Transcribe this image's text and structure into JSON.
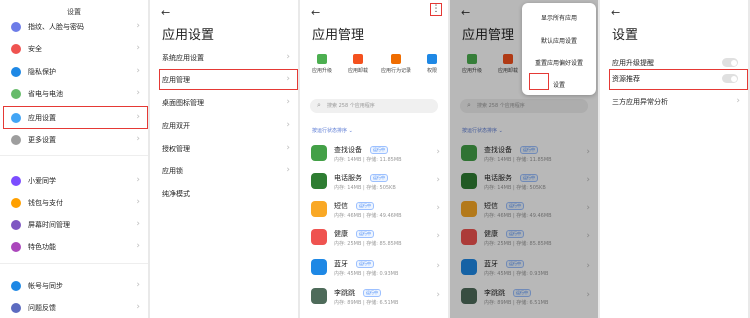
{
  "panel1": {
    "title": "设置",
    "items": [
      {
        "label": "指纹、人脸与密码",
        "color": "#6d7ce8"
      },
      {
        "label": "安全",
        "color": "#ef5350"
      },
      {
        "label": "隐私保护",
        "color": "#1e88e5"
      },
      {
        "label": "省电与电池",
        "color": "#66bb6a"
      },
      {
        "label": "应用设置",
        "color": "#42a5f5"
      },
      {
        "label": "更多设置",
        "color": "#9e9e9e"
      },
      {
        "label": "小爱同学",
        "color": "#7c4dff"
      },
      {
        "label": "钱包与支付",
        "color": "#ffa000"
      },
      {
        "label": "屏幕时间管理",
        "color": "#7e57c2"
      },
      {
        "label": "特色功能",
        "color": "#ab47bc"
      },
      {
        "label": "帐号与同步",
        "color": "#1e88e5"
      },
      {
        "label": "问题反馈",
        "color": "#5c6bc0"
      }
    ]
  },
  "panel2": {
    "title": "应用设置",
    "items": [
      "系统应用设置",
      "应用管理",
      "桌面图标管理",
      "应用双开",
      "授权管理",
      "应用锁",
      "纯净模式"
    ]
  },
  "panel3": {
    "title": "应用管理",
    "more_glyph": "⋮",
    "toolbar": [
      {
        "label": "应用升级",
        "color": "#4caf50"
      },
      {
        "label": "应用卸载",
        "color": "#f4511e"
      },
      {
        "label": "应用行为记录",
        "color": "#ef6c00"
      },
      {
        "label": "权限",
        "color": "#1e88e5"
      }
    ],
    "search_placeholder": "搜索 258 个应用程序",
    "sort_label": "按运行状态排序 ⌄",
    "apps": [
      {
        "name": "查找设备",
        "badge": "运行中",
        "meta": "内存: 14MB | 存储: 11.85MB",
        "color": "#43a047"
      },
      {
        "name": "电话服务",
        "badge": "运行中",
        "meta": "内存: 14MB | 存储: 505KB",
        "color": "#2e7d32"
      },
      {
        "name": "短信",
        "badge": "运行中",
        "meta": "内存: 46MB | 存储: 49.46MB",
        "color": "#f9a825"
      },
      {
        "name": "健康",
        "badge": "运行中",
        "meta": "内存: 25MB | 存储: 85.85MB",
        "color": "#ef5350"
      },
      {
        "name": "蓝牙",
        "badge": "运行中",
        "meta": "内存: 45MB | 存储: 0.93MB",
        "color": "#1e88e5"
      },
      {
        "name": "李跳跳",
        "badge": "运行中",
        "meta": "内存: 89MB | 存储: 6.51MB",
        "color": "#4e6b5a"
      }
    ]
  },
  "panel4": {
    "menu": [
      "显示所有应用",
      "默认应用设置",
      "重置应用偏好设置",
      "设置"
    ]
  },
  "panel5": {
    "title": "设置",
    "items": [
      "应用升级提醒",
      "资源推荐",
      "三方应用异常分析"
    ]
  },
  "back_glyph": "←",
  "chevron_glyph": "›",
  "search_glyph": "⌕"
}
